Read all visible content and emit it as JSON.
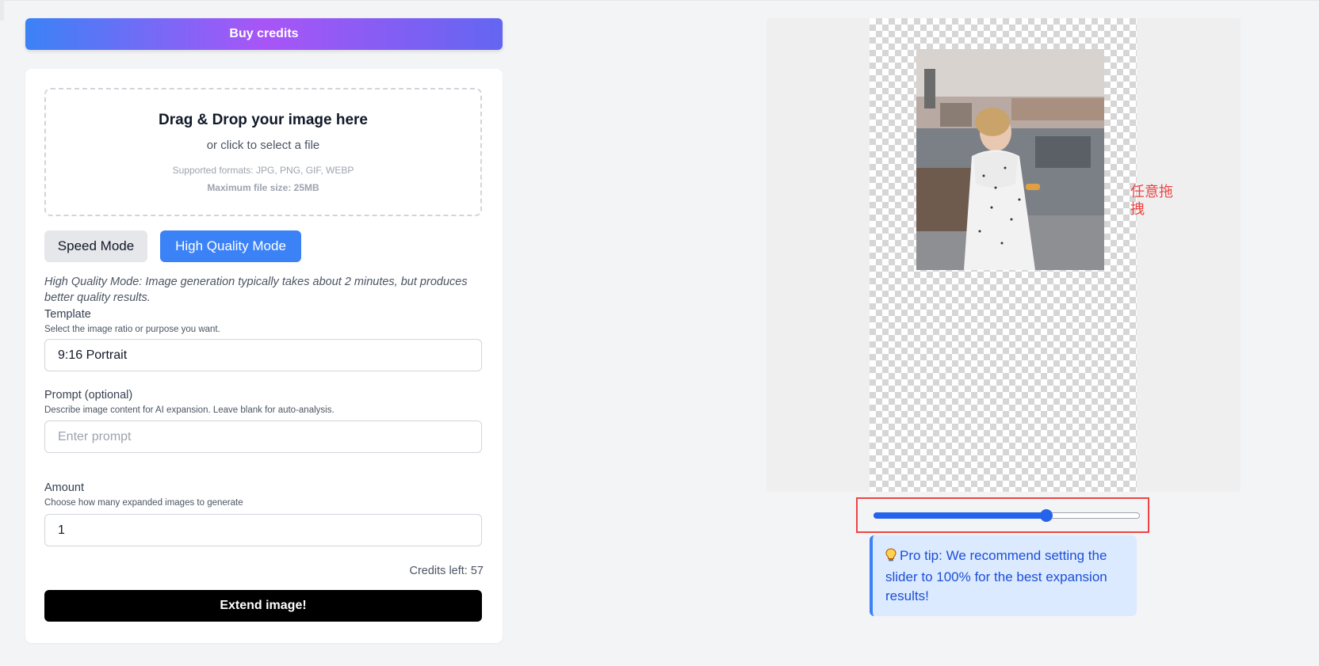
{
  "header": {
    "buy_credits_label": "Buy credits"
  },
  "upload": {
    "title": "Drag & Drop your image here",
    "subtitle": "or click to select a file",
    "formats": "Supported formats: JPG, PNG, GIF, WEBP",
    "max_size": "Maximum file size: 25MB"
  },
  "modes": {
    "speed_label": "Speed Mode",
    "hq_label": "High Quality Mode",
    "selected": "High Quality Mode",
    "description": "High Quality Mode: Image generation typically takes about 2 minutes, but produces better quality results."
  },
  "template": {
    "label": "Template",
    "help": "Select the image ratio or purpose you want.",
    "value": "9:16 Portrait"
  },
  "prompt": {
    "label": "Prompt (optional)",
    "help": "Describe image content for AI expansion. Leave blank for auto-analysis.",
    "placeholder": "Enter prompt",
    "value": ""
  },
  "amount": {
    "label": "Amount",
    "help": "Choose how many expanded images to generate",
    "value": "1"
  },
  "credits_text": "Credits left: 57",
  "extend_label": "Extend image!",
  "preview": {
    "drag_note": "任意拖拽",
    "slider_value": 0.65
  },
  "tip": {
    "icon": "lightbulb-icon",
    "text": "Pro tip: We recommend setting the slider to 100% for the best expansion results!"
  },
  "colors": {
    "primary": "#3b82f6",
    "accent_purple": "#a855f7",
    "annotation_red": "#ef4444"
  }
}
